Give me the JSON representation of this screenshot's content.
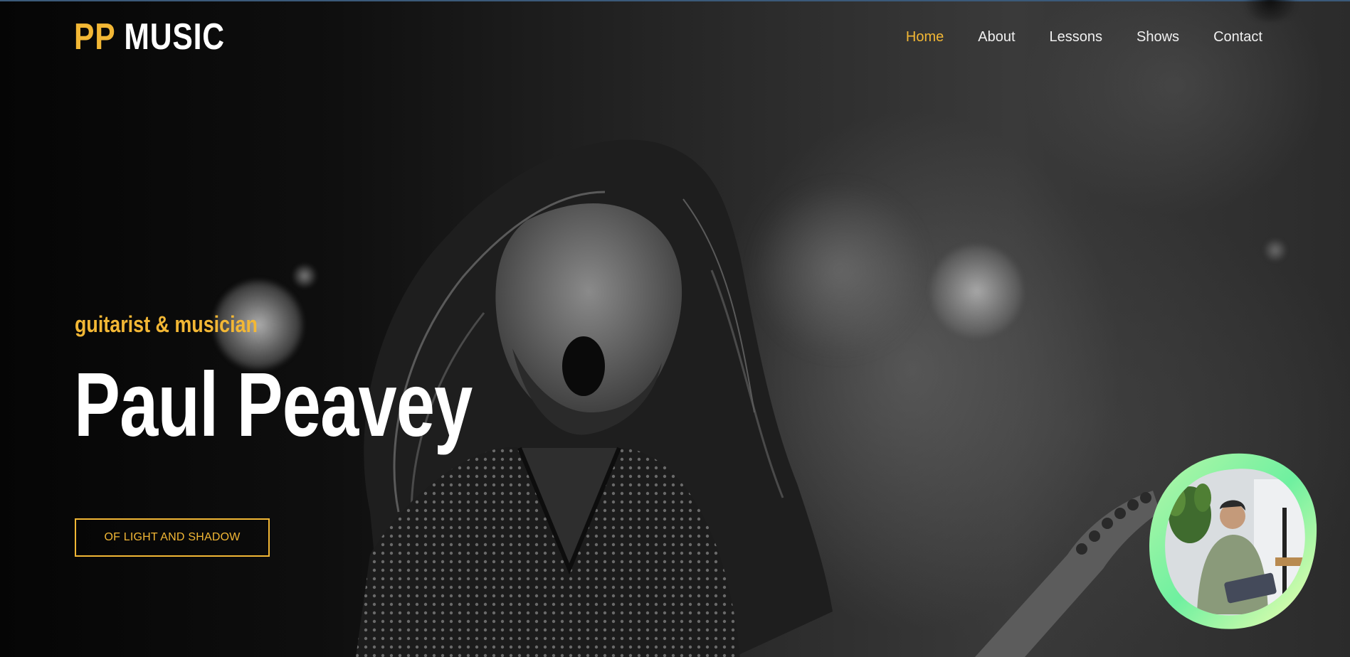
{
  "header": {
    "logo_pp": "PP",
    "logo_music": "MUSIC",
    "nav": [
      {
        "label": "Home",
        "active": true
      },
      {
        "label": "About",
        "active": false
      },
      {
        "label": "Lessons",
        "active": false
      },
      {
        "label": "Shows",
        "active": false
      },
      {
        "label": "Contact",
        "active": false
      }
    ]
  },
  "hero": {
    "tagline": "guitarist & musician",
    "name": "Paul Peavey",
    "cta_label": "OF LIGHT AND SHADOW"
  },
  "colors": {
    "accent": "#f2b735",
    "text": "#ffffff",
    "background": "#0b0b0b"
  }
}
